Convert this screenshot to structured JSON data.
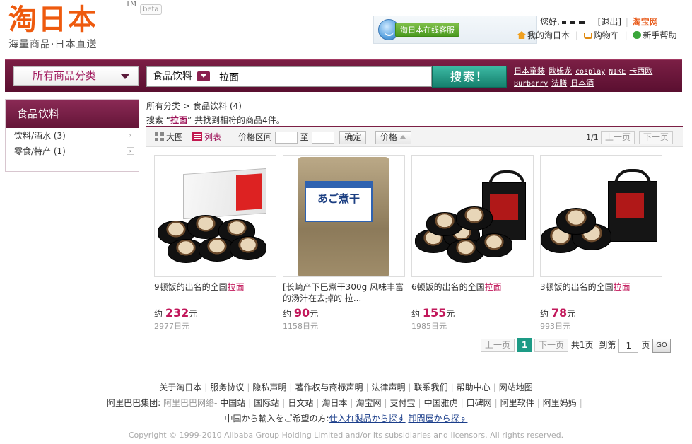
{
  "header": {
    "logo_text": "淘日本",
    "logo_tm": "TM",
    "logo_tagline": "海量商品·日本直送",
    "beta": "beta",
    "service_button": "淘日本在线客服",
    "greeting": "您好,",
    "logout": "[退出]",
    "taobao_logo": "淘宝网",
    "links": [
      "我的淘日本",
      "购物车",
      "新手帮助"
    ]
  },
  "search": {
    "category_select": "所有商品分类",
    "scope": "食品饮料",
    "query": "拉面",
    "button": "搜索！",
    "hot_links": [
      "日本童装",
      "欧姆龙",
      "cosplay",
      "NIKE",
      "卡西欧",
      "Burberry",
      "法膳",
      "日本酒"
    ]
  },
  "sidebar": {
    "title": "食品饮料",
    "items": [
      "饮料/酒水 (3)",
      "零食/特产 (1)"
    ]
  },
  "breadcrumb": {
    "root": "所有分类",
    "sep": ">",
    "current": "食品饮料 (4)"
  },
  "result_summary": {
    "prefix": "搜索 “",
    "keyword": "拉面",
    "suffix": "” 共找到相符的商品4件。"
  },
  "toolbar": {
    "view_grid": "大图",
    "view_list": "列表",
    "price_range": "价格区间",
    "to": "至",
    "confirm": "确定",
    "sort_price": "价格",
    "page_count": "1/1",
    "prev": "上一页",
    "next": "下一页"
  },
  "products": [
    {
      "name_prefix": "9顿饭的出名的全国",
      "name_highlight": "拉面",
      "approx": "约",
      "price": "232",
      "unit": "元",
      "yen": "2977日元"
    },
    {
      "name_prefix": "[长崎产下巴煮干300g 风味丰富的汤汁在去掉的 拉...",
      "name_highlight": "",
      "approx": "约",
      "price": "90",
      "unit": "元",
      "yen": "1158日元",
      "label": "あご煮干"
    },
    {
      "name_prefix": "6顿饭的出名的全国",
      "name_highlight": "拉面",
      "approx": "约",
      "price": "155",
      "unit": "元",
      "yen": "1985日元"
    },
    {
      "name_prefix": "3顿饭的出名的全国",
      "name_highlight": "拉面",
      "approx": "约",
      "price": "78",
      "unit": "元",
      "yen": "993日元"
    }
  ],
  "pagination": {
    "prev": "上一页",
    "current": "1",
    "next": "下一页",
    "total": "共1页",
    "goto_label": "到第",
    "goto_value": "1",
    "page_unit": "页",
    "go": "GO"
  },
  "footer": {
    "links": [
      "关于淘日本",
      "服务协议",
      "隐私声明",
      "著作权与商标声明",
      "法律声明",
      "联系我们",
      "帮助中心",
      "网站地图"
    ],
    "group_label": "阿里巴巴集团:",
    "group_links": [
      "阿里巴巴网络-",
      "中国站",
      "国际站",
      "日文站",
      "淘日本",
      "淘宝网",
      "支付宝",
      "中国雅虎",
      "口碑网",
      "阿里软件",
      "阿里妈妈"
    ],
    "japan_label": "中国から輸入をご希望の方:",
    "japan_links": [
      "仕入れ製品から探す",
      "卸問屋から探す"
    ],
    "copyright": "Copyright © 1999-2010 Alibaba Group Holding Limited and/or its subsidiaries and licensors. All rights reserved."
  }
}
